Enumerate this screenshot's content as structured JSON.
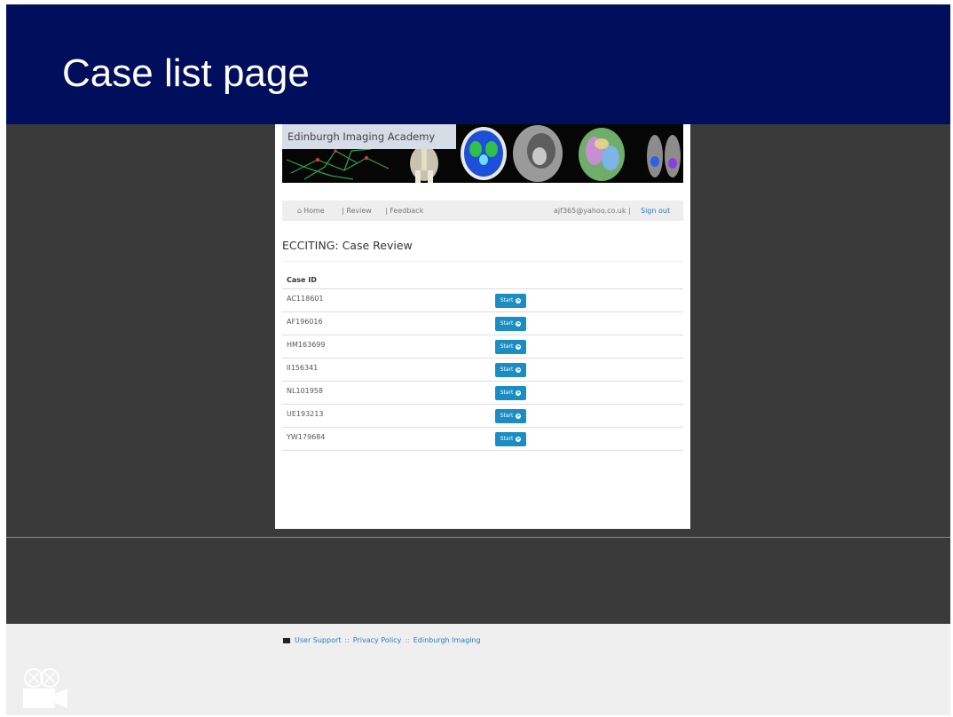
{
  "slide": {
    "title": "Case list page"
  },
  "app": {
    "banner_title": "Edinburgh Imaging Academy",
    "nav": {
      "home": "Home",
      "review": "| Review",
      "feedback": "| Feedback",
      "user_email": "ajf365@yahoo.co.uk |",
      "sign_out": "Sign out"
    },
    "page_heading": "ECCITING: Case Review",
    "table": {
      "column_header": "Case ID",
      "button_label": "Start",
      "rows": [
        {
          "case_id": "AC118601"
        },
        {
          "case_id": "AF196016"
        },
        {
          "case_id": "HM163699"
        },
        {
          "case_id": "II156341"
        },
        {
          "case_id": "NL101958"
        },
        {
          "case_id": "UE193213"
        },
        {
          "case_id": "YW179684"
        }
      ]
    }
  },
  "footer": {
    "user_support": "User Support",
    "separator": "::",
    "privacy_policy": "Privacy Policy",
    "edinburgh_imaging": "Edinburgh Imaging"
  },
  "colors": {
    "header_navy": "#000e5c",
    "backdrop_gray": "#3a3a3a",
    "button_blue": "#1a8dc2",
    "link_blue": "#2a7bbf"
  },
  "icons": {
    "home": "home-icon",
    "start_arrow": "arrow-circle-right-icon",
    "mail": "envelope-icon",
    "video": "video-camera-icon"
  }
}
